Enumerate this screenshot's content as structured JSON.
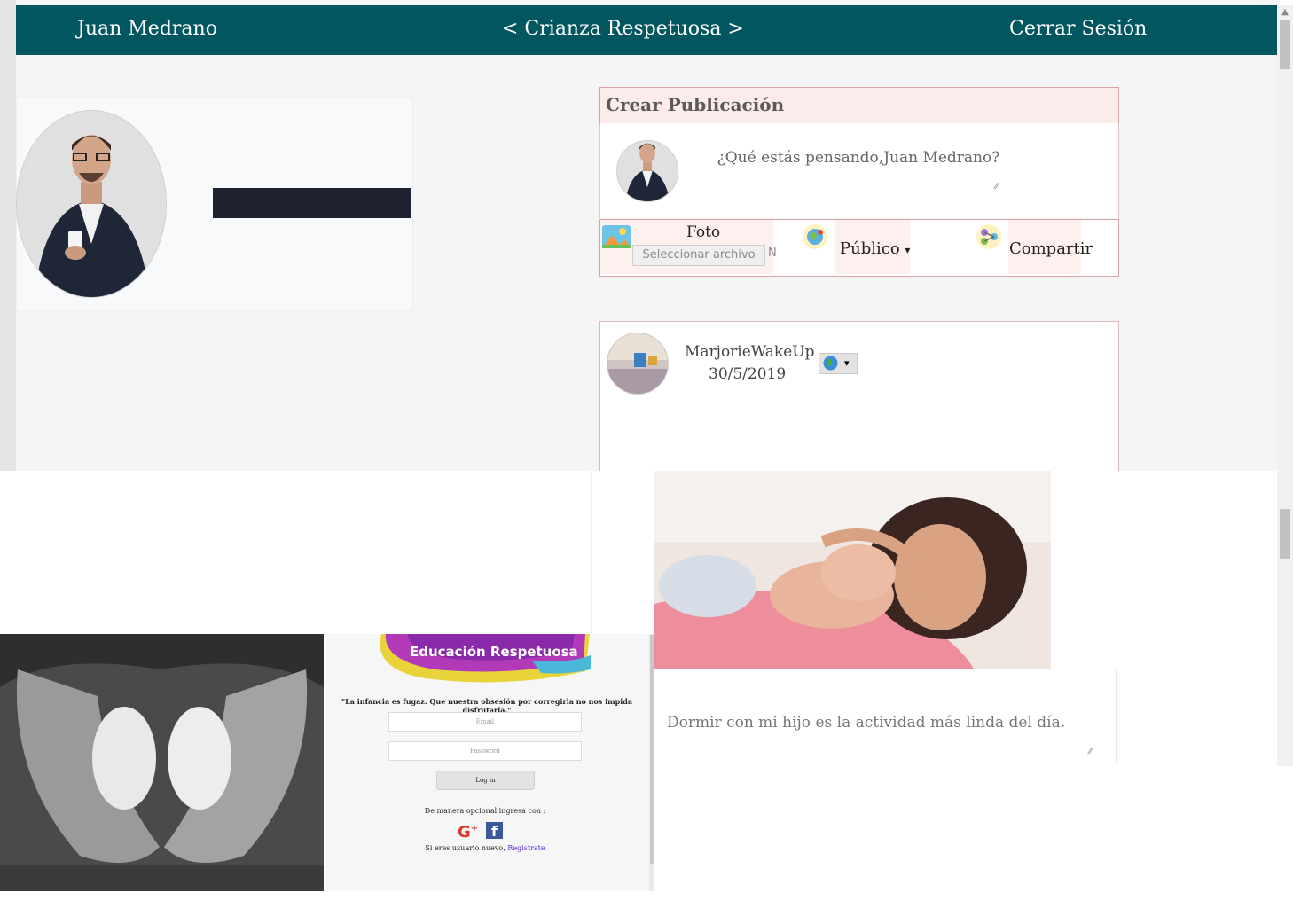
{
  "navbar": {
    "user_name": "Juan Medrano",
    "title": "< Crianza Respetuosa >",
    "logout": "Cerrar Sesión"
  },
  "create_post": {
    "title": "Crear Publicación",
    "placeholder": "¿Qué estás pensando,Juan Medrano?",
    "photo_label": "Foto",
    "file_button": "Seleccionar archivo",
    "file_status": "N",
    "privacy_label": "Público",
    "privacy_arrow": "▾",
    "share_label": "Compartir"
  },
  "feed_post": {
    "author": "MarjorieWakeUp",
    "date": "30/5/2019",
    "privacy_arrow": "▾",
    "caption": "Dormir con mi hijo es la actividad más linda del día."
  },
  "login_page": {
    "brand": "Educación Respetuosa",
    "quote": "\"La infancia es fugaz. Que nuestra obsesión por corregirla no nos impida disfrutarla.\"",
    "email_placeholder": "Email",
    "password_placeholder": "Password",
    "login_button": "Log in",
    "optional_text": "De manera opcional ingresa con :",
    "register_text": "Si eres usuario nuevo, ",
    "register_link": "Registrate"
  },
  "colors": {
    "navbar": "#02565f",
    "header_pink": "#fbeceb",
    "border_pink": "#d8a3a5"
  },
  "icons": [
    "photo-icon",
    "globe-icon",
    "share-icon",
    "google-plus-icon",
    "facebook-icon",
    "resize-handle-icon"
  ]
}
